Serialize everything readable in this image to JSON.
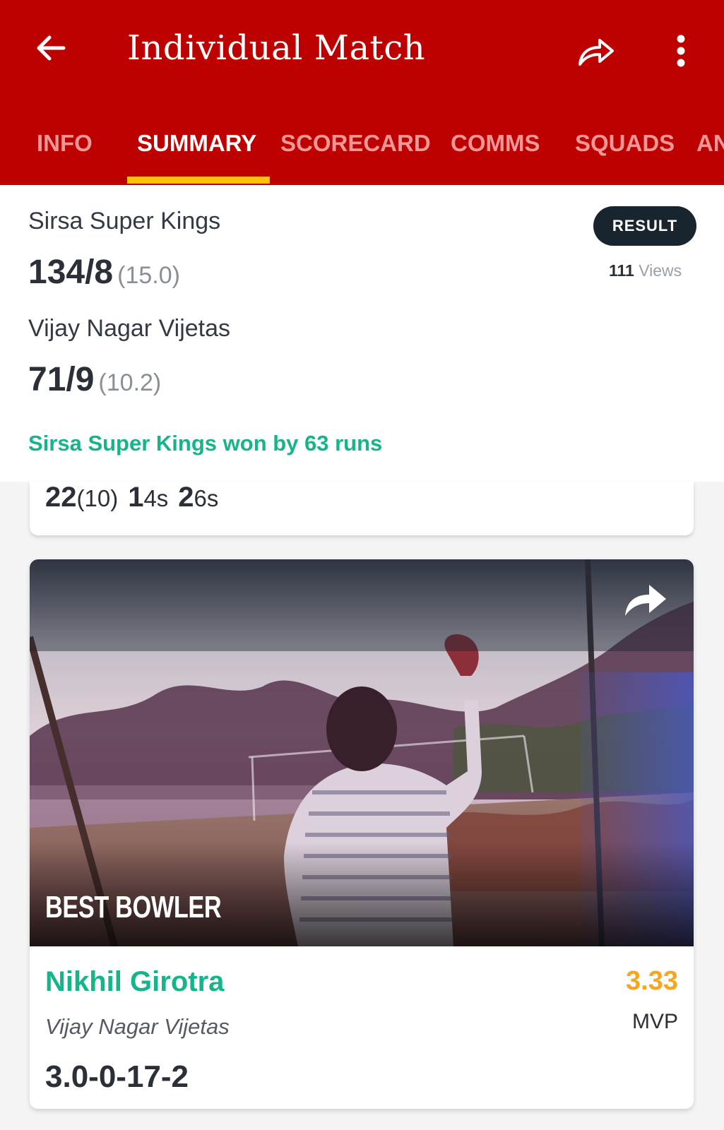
{
  "header": {
    "title": "Individual Match",
    "back_icon": "arrow-left-icon",
    "share_icon": "share-icon",
    "more_icon": "more-vertical-icon",
    "brand_color": "#bd0000"
  },
  "tabs": [
    {
      "label": "INFO",
      "active": false
    },
    {
      "label": "SUMMARY",
      "active": true
    },
    {
      "label": "SCORECARD",
      "active": false
    },
    {
      "label": "COMMS",
      "active": false
    },
    {
      "label": "SQUADS",
      "active": false
    },
    {
      "label": "AN",
      "active": false
    }
  ],
  "tab_indicator_color": "#ffc107",
  "match": {
    "teams": [
      {
        "name": "Sirsa Super Kings",
        "score": "134/8",
        "overs": "(15.0)"
      },
      {
        "name": "Vijay Nagar Vijetas",
        "score": "71/9",
        "overs": "(10.2)"
      }
    ],
    "status_badge": "RESULT",
    "views_count": "111",
    "views_label": "Views",
    "result_text": "Sirsa Super Kings won by 63 runs",
    "result_color": "#16b48a"
  },
  "best_batter_stats": {
    "runs": "22",
    "balls": "(10)",
    "fours_count": "1",
    "fours_label": "4s",
    "sixes_count": "2",
    "sixes_label": "6s"
  },
  "best_bowler": {
    "award_label": "BEST BOWLER",
    "player_name": "Nikhil Girotra",
    "team": "Vijay Nagar Vijetas",
    "figures": "3.0-0-17-2",
    "mvp_value": "3.33",
    "mvp_label": "MVP",
    "share_icon": "share-icon",
    "mvp_color": "#f5a623"
  }
}
